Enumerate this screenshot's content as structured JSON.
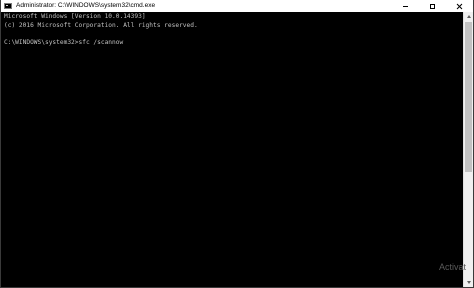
{
  "window": {
    "title": "Administrator: C:\\WINDOWS\\system32\\cmd.exe",
    "icon": "cmd-console-icon"
  },
  "controls": {
    "minimize_icon": "minimize-icon",
    "maximize_icon": "maximize-icon",
    "close_icon": "close-icon"
  },
  "console": {
    "lines": [
      "Microsoft Windows [Version 10.0.14393]",
      "(c) 2016 Microsoft Corporation. All rights reserved.",
      "",
      "C:\\WINDOWS\\system32>sfc /scannow"
    ],
    "text_color": "#c0c0c0",
    "background_color": "#000000"
  },
  "watermark": {
    "text": "Activat"
  }
}
